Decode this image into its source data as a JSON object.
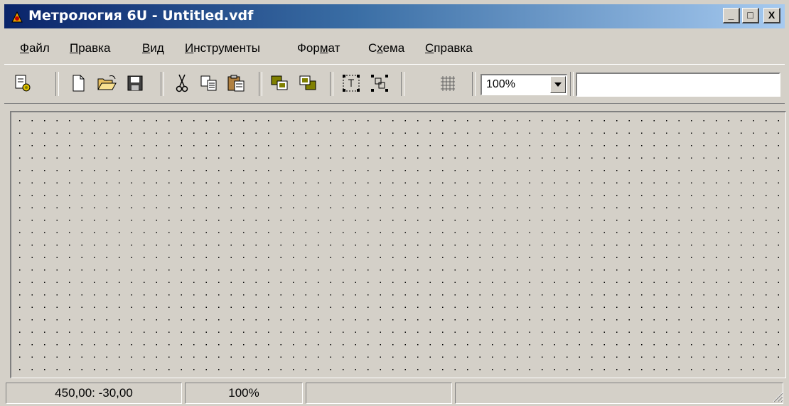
{
  "window": {
    "title": "Метрология 6U - Untitled.vdf",
    "minimize_glyph": "_",
    "maximize_glyph": "□",
    "close_glyph": "X"
  },
  "menu": {
    "items": [
      {
        "underline": "Ф",
        "rest": "айл"
      },
      {
        "underline": "П",
        "rest": "равка"
      },
      {
        "underline": "В",
        "rest": "ид"
      },
      {
        "underline": "И",
        "rest": "нструменты"
      },
      {
        "pre": "Фор",
        "underline": "м",
        "rest": "ат"
      },
      {
        "pre": "С",
        "underline": "х",
        "rest": "ема"
      },
      {
        "underline": "С",
        "rest": "правка"
      }
    ]
  },
  "toolbar": {
    "zoom_value": "100%",
    "text_field_value": "",
    "icons": [
      "properties-icon",
      "new-icon",
      "open-icon",
      "save-icon",
      "cut-icon",
      "copy-icon",
      "paste-icon",
      "bring-front-icon",
      "send-back-icon",
      "group-icon",
      "ungroup-icon",
      "grid-icon"
    ]
  },
  "statusbar": {
    "coordinates": "450,00: -30,00",
    "zoom": "100%",
    "panel3": "",
    "panel4": ""
  },
  "colors": {
    "face": "#d4d0c8",
    "title_start": "#0a246a",
    "title_end": "#a6caf0"
  }
}
